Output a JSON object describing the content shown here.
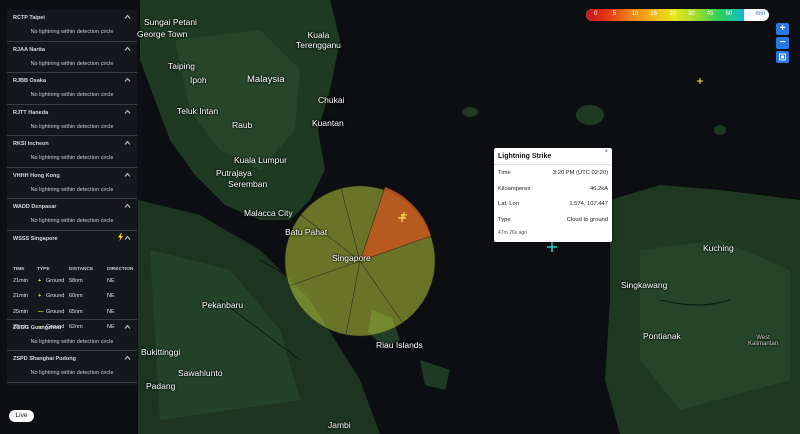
{
  "sidebar": {
    "panels": [
      {
        "title": "RCTP Taipei",
        "message": "No lightning within detection circle"
      },
      {
        "title": "RJAA Narita",
        "message": "No lightning within detection circle"
      },
      {
        "title": "RJBB Osaka",
        "message": "No lightning within detection circle"
      },
      {
        "title": "RJTT Haneda",
        "message": "No lightning within detection circle"
      },
      {
        "title": "RKSI Incheon",
        "message": "No lightning within detection circle"
      },
      {
        "title": "VHHH Hong Kong",
        "message": "No lightning within detection circle"
      },
      {
        "title": "WADD Denpasar",
        "message": "No lightning within detection circle"
      }
    ],
    "open_panel": {
      "title": "WSSS Singapore",
      "columns": [
        "TIME",
        "TYPE",
        "DISTANCE",
        "DIRECTION"
      ],
      "rows": [
        {
          "time": "21min",
          "type": "Ground",
          "distance": "58nm",
          "direction": "NE"
        },
        {
          "time": "21min",
          "type": "Ground",
          "distance": "60nm",
          "direction": "NE"
        },
        {
          "time": "25min",
          "type": "Ground",
          "distance": "65nm",
          "direction": "NE"
        },
        {
          "time": "25min",
          "type": "Ground",
          "distance": "62nm",
          "direction": "NE"
        }
      ]
    },
    "panels_after": [
      {
        "title": "ZGGG Guangzhou",
        "message": "No lightning within detection circle"
      },
      {
        "title": "ZSPD Shanghai Pudong",
        "message": "No lightning within detection circle"
      }
    ]
  },
  "legend": {
    "labels": [
      "0",
      "5",
      "10",
      "15",
      "20",
      "30",
      "45",
      "60"
    ],
    "unit": "min"
  },
  "zoom": {
    "in": "+",
    "out": "−"
  },
  "popup": {
    "title": "Lightning Strike",
    "close": "×",
    "rows": [
      {
        "key": "Time",
        "value": "3:20 PM (UTC 02:20)"
      },
      {
        "key": "Kiloamperes",
        "value": "46.2kA"
      },
      {
        "key": "Lat, Lon",
        "value": "1.574, 107.447"
      },
      {
        "key": "Type",
        "value": "Cloud to ground"
      }
    ],
    "age": "47m 26s ago"
  },
  "live_button": "Live",
  "map_labels": {
    "sungai_petani": "Sungai Petani",
    "george_town": "George Town",
    "kuala_terengganu": "Kuala\nTerengganu",
    "taiping": "Taiping",
    "ipoh": "Ipoh",
    "malaysia": "Malaysia",
    "chukai": "Chukai",
    "teluk_intan": "Teluk Intan",
    "raub": "Raub",
    "kuantan": "Kuantan",
    "kuala_lumpur": "Kuala Lumpur",
    "putrajaya": "Putrajaya",
    "seremban": "Seremban",
    "malacca": "Malacca City",
    "batu_pahat": "Batu Pahat",
    "singapore": "Singapore",
    "pekanbaru": "Pekanbaru",
    "bukittinggi": "Bukittinggi",
    "padang": "Padang",
    "sawahlunto": "Sawahlunto",
    "riau": "Riau Islands",
    "jambi": "Jambi",
    "kuching": "Kuching",
    "singkawang": "Singkawang",
    "pontianak": "Pontianak",
    "west_kalimantan": "West\nKalimantan"
  },
  "colors": {
    "detection_circle": "#b8c93a",
    "active_sector": "#c4561e",
    "accent": "#2a78e6",
    "strike_marker": "#1fd1c3"
  }
}
